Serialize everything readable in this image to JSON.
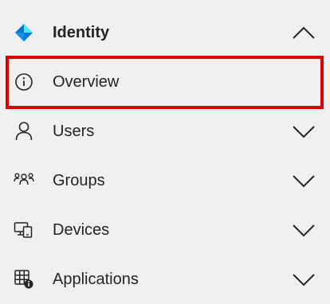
{
  "nav": {
    "items": [
      {
        "label": "Identity",
        "icon": "identity-diamond-icon",
        "chevron": "chevron-up-icon",
        "expanded": true,
        "bold": true
      },
      {
        "label": "Overview",
        "icon": "info-circle-icon",
        "highlighted": true
      },
      {
        "label": "Users",
        "icon": "person-icon",
        "chevron": "chevron-down-icon"
      },
      {
        "label": "Groups",
        "icon": "people-group-icon",
        "chevron": "chevron-down-icon"
      },
      {
        "label": "Devices",
        "icon": "devices-icon",
        "chevron": "chevron-down-icon"
      },
      {
        "label": "Applications",
        "icon": "apps-grid-icon",
        "chevron": "chevron-down-icon"
      }
    ]
  },
  "colors": {
    "background": "#f0f0f0",
    "text": "#242424",
    "highlight_border": "#e00000",
    "icon_stroke": "#242424",
    "identity_blue_light": "#50e6ff",
    "identity_blue_dark": "#0078d4"
  }
}
